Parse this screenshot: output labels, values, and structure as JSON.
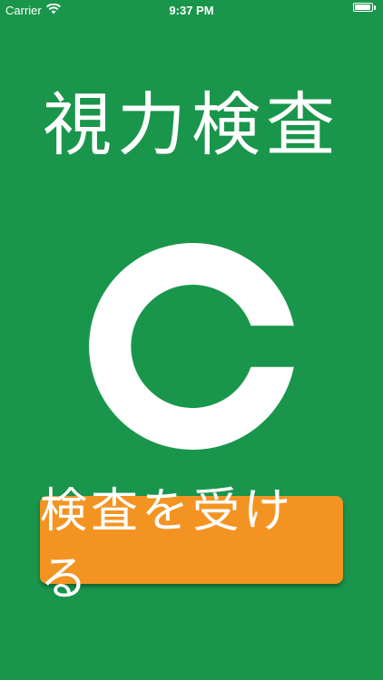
{
  "status_bar": {
    "carrier": "Carrier",
    "time": "9:37 PM",
    "battery_level": 1.0
  },
  "title": "視力検査",
  "optotype": {
    "name": "landolt-c",
    "color": "#ffffff"
  },
  "start_button": {
    "label": "検査を受ける"
  },
  "colors": {
    "background": "#19964b",
    "button": "#f39422",
    "text": "#ffffff"
  }
}
